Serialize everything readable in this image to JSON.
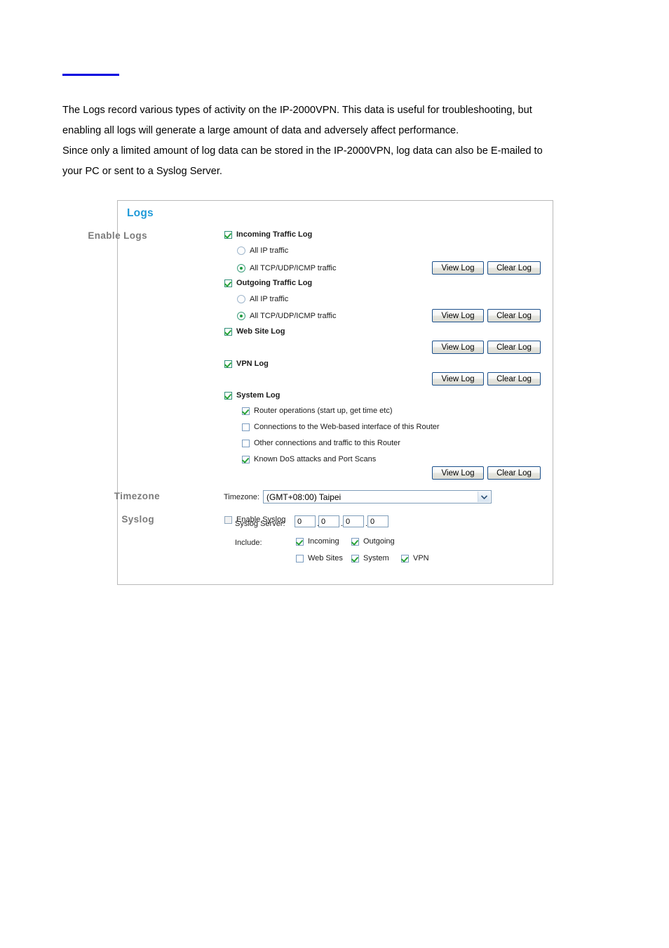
{
  "document": {
    "paragraphs": [
      "The Logs record various types of activity on the IP-2000VPN. This data is useful for troubleshooting, but",
      "enabling all logs will generate a large amount of data and adversely affect performance.",
      "Since only a limited amount of log data can be stored in the IP-2000VPN, log data can also be E-mailed to",
      "your PC or sent to a Syslog Server."
    ]
  },
  "colors": {
    "heading_blue": "#1f9ad8",
    "rule_blue": "#0000e0",
    "section_label_gray": "#7b7b7b",
    "check_green": "#2aa33a",
    "button_border": "#1b4f8a",
    "panel_border": "#b9b9b9"
  },
  "panel": {
    "title": "Logs",
    "sections": {
      "enable_logs": {
        "label": "Enable Logs",
        "incoming": {
          "checkbox_label": "Incoming Traffic Log",
          "checked": true,
          "radio_all_ip": "All IP traffic",
          "radio_all_tcp": "All TCP/UDP/ICMP traffic",
          "selected": "All TCP/UDP/ICMP traffic"
        },
        "outgoing": {
          "checkbox_label": "Outgoing Traffic Log",
          "checked": true,
          "radio_all_ip": "All IP traffic",
          "radio_all_tcp": "All TCP/UDP/ICMP traffic",
          "selected": "All TCP/UDP/ICMP traffic"
        },
        "web_site": {
          "checkbox_label": "Web Site Log",
          "checked": true
        },
        "vpn": {
          "checkbox_label": "VPN Log",
          "checked": true
        },
        "system": {
          "checkbox_label": "System Log",
          "checked": true,
          "options": [
            {
              "label": "Router operations (start up, get time etc)",
              "checked": true
            },
            {
              "label": "Connections to the Web-based interface of this Router",
              "checked": false
            },
            {
              "label": "Other connections and traffic to this Router",
              "checked": false
            },
            {
              "label": "Known DoS attacks and Port Scans",
              "checked": true
            }
          ]
        },
        "buttons": {
          "view": "View Log",
          "clear": "Clear Log"
        }
      },
      "timezone": {
        "label": "Timezone",
        "field_label": "Timezone:",
        "value": "(GMT+08:00) Taipei"
      },
      "syslog": {
        "label": "Syslog",
        "enable_label": "Enable Syslog",
        "enable_checked": false,
        "server_label": "Syslog Server:",
        "server_octets": [
          "0",
          "0",
          "0",
          "0"
        ],
        "include_label": "Include:",
        "include_row1": [
          {
            "label": "Incoming",
            "checked": true
          },
          {
            "label": "Outgoing",
            "checked": true
          }
        ],
        "include_row2": [
          {
            "label": "Web Sites",
            "checked": false
          },
          {
            "label": "System",
            "checked": true
          },
          {
            "label": "VPN",
            "checked": true
          }
        ]
      }
    }
  }
}
